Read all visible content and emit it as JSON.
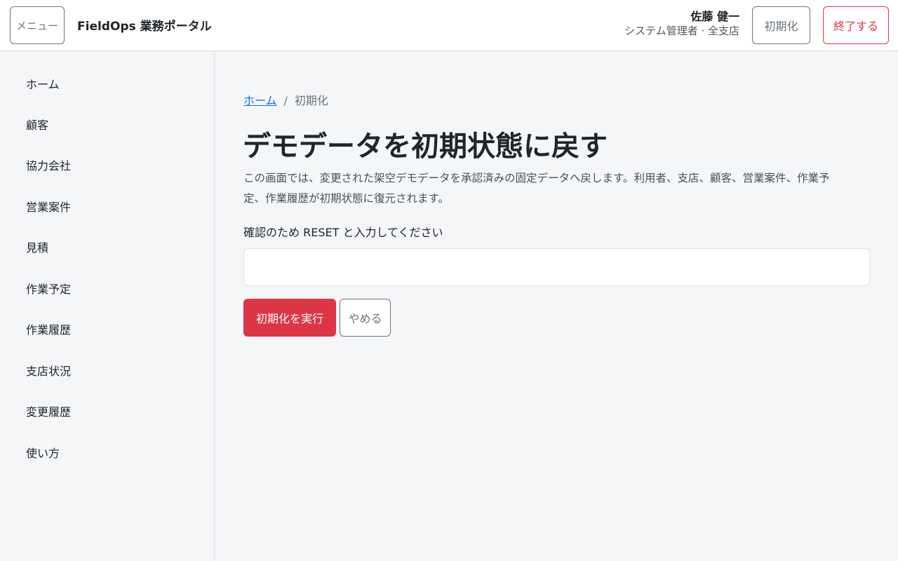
{
  "header": {
    "menu_label": "メニュー",
    "brand": "FieldOps 業務ポータル",
    "user_name": "佐藤 健一",
    "user_role": "システム管理者 · 全支店",
    "reset_label": "初期化",
    "exit_label": "終了する"
  },
  "sidebar": {
    "items": [
      {
        "label": "ホーム"
      },
      {
        "label": "顧客"
      },
      {
        "label": "協力会社"
      },
      {
        "label": "営業案件"
      },
      {
        "label": "見積"
      },
      {
        "label": "作業予定"
      },
      {
        "label": "作業履歴"
      },
      {
        "label": "支店状況"
      },
      {
        "label": "変更履歴"
      },
      {
        "label": "使い方"
      }
    ]
  },
  "breadcrumb": {
    "home": "ホーム",
    "separator": "/",
    "current": "初期化"
  },
  "main": {
    "title": "デモデータを初期状態に戻す",
    "description": "この画面では、変更された架空デモデータを承認済みの固定データへ戻します。利用者、支店、顧客、営業案件、作業予定、作業履歴が初期状態に復元されます。",
    "confirm_label": "確認のため RESET と入力してください",
    "confirm_value": "",
    "execute_label": "初期化を実行",
    "cancel_label": "やめる"
  },
  "colors": {
    "danger": "#dc3545",
    "link": "#0d6efd",
    "secondary": "#6c757d",
    "background": "#f5f6f8"
  }
}
